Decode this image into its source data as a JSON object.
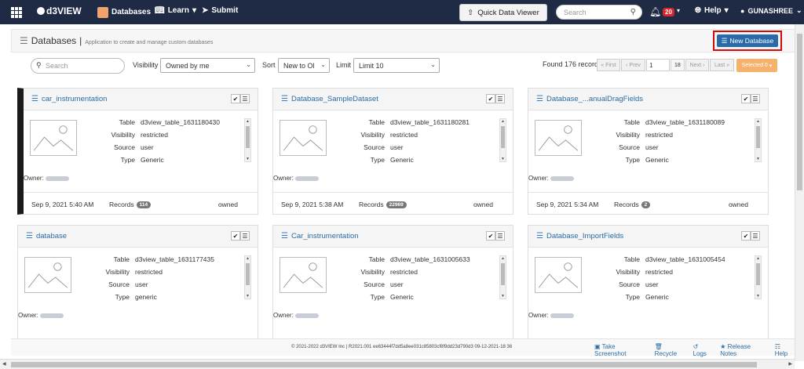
{
  "navbar": {
    "logo": "d3VIEW",
    "databases": "Databases",
    "learn": "Learn",
    "submit": "Submit",
    "quick_data_viewer": "Quick Data Viewer",
    "search_placeholder": "Search",
    "notifications": "20",
    "help": "Help",
    "user": "Gunashree",
    "colors": {
      "bg": "#1f2a44",
      "badge": "#d9262e"
    }
  },
  "header": {
    "title": "Databases",
    "subtitle": "Application to create and manage custom databases",
    "new_database": "New Database"
  },
  "filters": {
    "search_placeholder": "Search",
    "visibility_label": "Visibility",
    "visibility_value": "Owned by me",
    "sort_label": "Sort",
    "sort_value": "New to Ol",
    "limit_label": "Limit",
    "limit_value": "Limit 10",
    "found": "Found 176 records",
    "first": "« First",
    "prev": "‹ Prev",
    "page": "1",
    "total_pages": "18",
    "next": "Next ›",
    "last": "Last »",
    "selected": "Selected 0"
  },
  "cards": [
    {
      "title": "car_instrumentation",
      "table": "d3view_table_1631180430",
      "visibility": "restricted",
      "source": "user",
      "type": "Generic",
      "date": "Sep 9, 2021 5:40 AM",
      "records": "114",
      "owned": "owned"
    },
    {
      "title": "Database_SampleDataset",
      "table": "d3view_table_1631180281",
      "visibility": "restricted",
      "source": "user",
      "type": "Generic",
      "date": "Sep 9, 2021 5:38 AM",
      "records": "22969",
      "owned": "owned"
    },
    {
      "title": "Database_...anualDragFields",
      "table": "d3view_table_1631180089",
      "visibility": "restricted",
      "source": "user",
      "type": "Generic",
      "date": "Sep 9, 2021 5:34 AM",
      "records": "2",
      "owned": "owned"
    },
    {
      "title": "database",
      "table": "d3view_table_1631177435",
      "visibility": "restricted",
      "source": "user",
      "type": "generic",
      "date": "",
      "records": "",
      "owned": ""
    },
    {
      "title": "Car_instrumentation",
      "table": "d3view_table_1631005633",
      "visibility": "restricted",
      "source": "user",
      "type": "Generic",
      "date": "",
      "records": "",
      "owned": ""
    },
    {
      "title": "Database_ImportFields",
      "table": "d3view_table_1631005454",
      "visibility": "restricted",
      "source": "user",
      "type": "Generic",
      "date": "",
      "records": "",
      "owned": ""
    }
  ],
  "labels": {
    "table": "Table",
    "visibility": "Visibility",
    "source": "Source",
    "type": "Type",
    "owner": "Owner:",
    "records": "Records"
  },
  "footer": {
    "copyright": "© 2021-2022 d3VIEW Inc | R2021.001 ee63444f7dd5a8ee031c85803cf8f9dd23d790d3 09-12-2021-18 36",
    "screenshot": "Take Screenshot",
    "recycle": "Recycle",
    "logs": "Logs",
    "release_notes": "Release Notes",
    "help": "Help"
  }
}
